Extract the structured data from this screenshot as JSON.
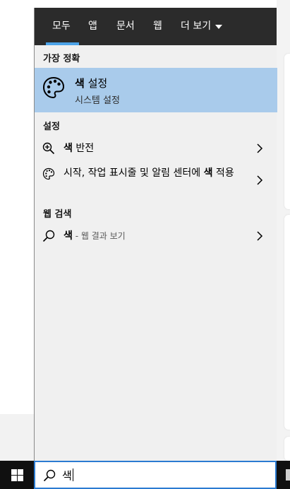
{
  "tabs": [
    "모두",
    "앱",
    "문서",
    "웹",
    "더 보기"
  ],
  "sections": {
    "best_match": "가장 정확",
    "settings": "설정",
    "web_search": "웹 검색"
  },
  "best_match": {
    "title_bold": "색",
    "title_rest": " 설정",
    "subtitle": "시스템 설정",
    "icon": "palette-icon"
  },
  "settings_results": [
    {
      "icon": "magnifier-plus-icon",
      "bold": "색",
      "rest": " 반전"
    },
    {
      "icon": "palette-icon",
      "text": "시작, 작업 표시줄 및 알림 센터에 ",
      "bold": "색",
      "text2": " 적용"
    }
  ],
  "web_result": {
    "icon": "search-icon",
    "query": "색",
    "suffix": " - 웹 결과 보기"
  },
  "search": {
    "query": "색",
    "icon": "search-icon"
  },
  "colors": {
    "tab_bar": "#2b2b2b",
    "accent": "#4ca3e8",
    "selection": "#a9cbeb",
    "panel": "#f0f0f0",
    "taskbar": "#101010"
  }
}
